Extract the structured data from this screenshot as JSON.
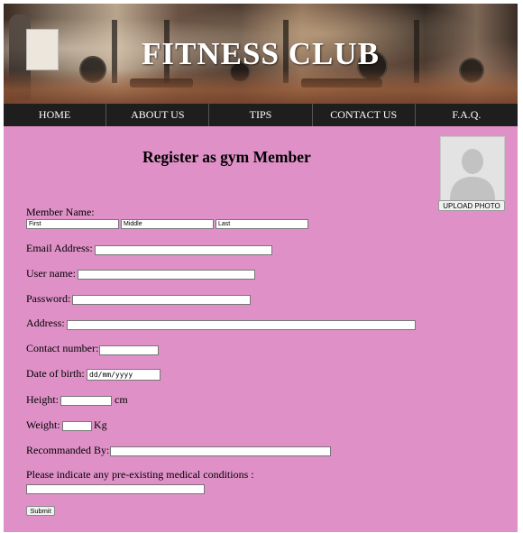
{
  "banner": {
    "title": "FITNESS CLUB"
  },
  "nav": {
    "items": [
      "HOME",
      "ABOUT US",
      "TIPS",
      "CONTACT US",
      "F.A.Q."
    ]
  },
  "form": {
    "title": "Register as gym Member",
    "upload_label": "UPLOAD PHOTO",
    "member_name_label": "Member Name:",
    "first_value": "First",
    "middle_value": "Middle",
    "last_value": "Last",
    "email_label": "Email Address:",
    "username_label": "User name:",
    "password_label": "Password:",
    "address_label": "Address:",
    "contact_label": "Contact number:",
    "dob_label": "Date of birth:",
    "dob_placeholder": "dd/mm/yyyy",
    "height_label": "Height:",
    "height_unit": "cm",
    "weight_label": "Weight:",
    "weight_unit": "Kg",
    "recommended_label": "Recommanded By:",
    "medical_label": "Please indicate any pre-existing medical conditions :",
    "submit_label": "Submit"
  },
  "colors": {
    "background": "#df91c7",
    "nav": "#1e1e1e",
    "title_text": "#ffffff"
  },
  "icons": {
    "avatar": "person-silhouette-icon"
  }
}
